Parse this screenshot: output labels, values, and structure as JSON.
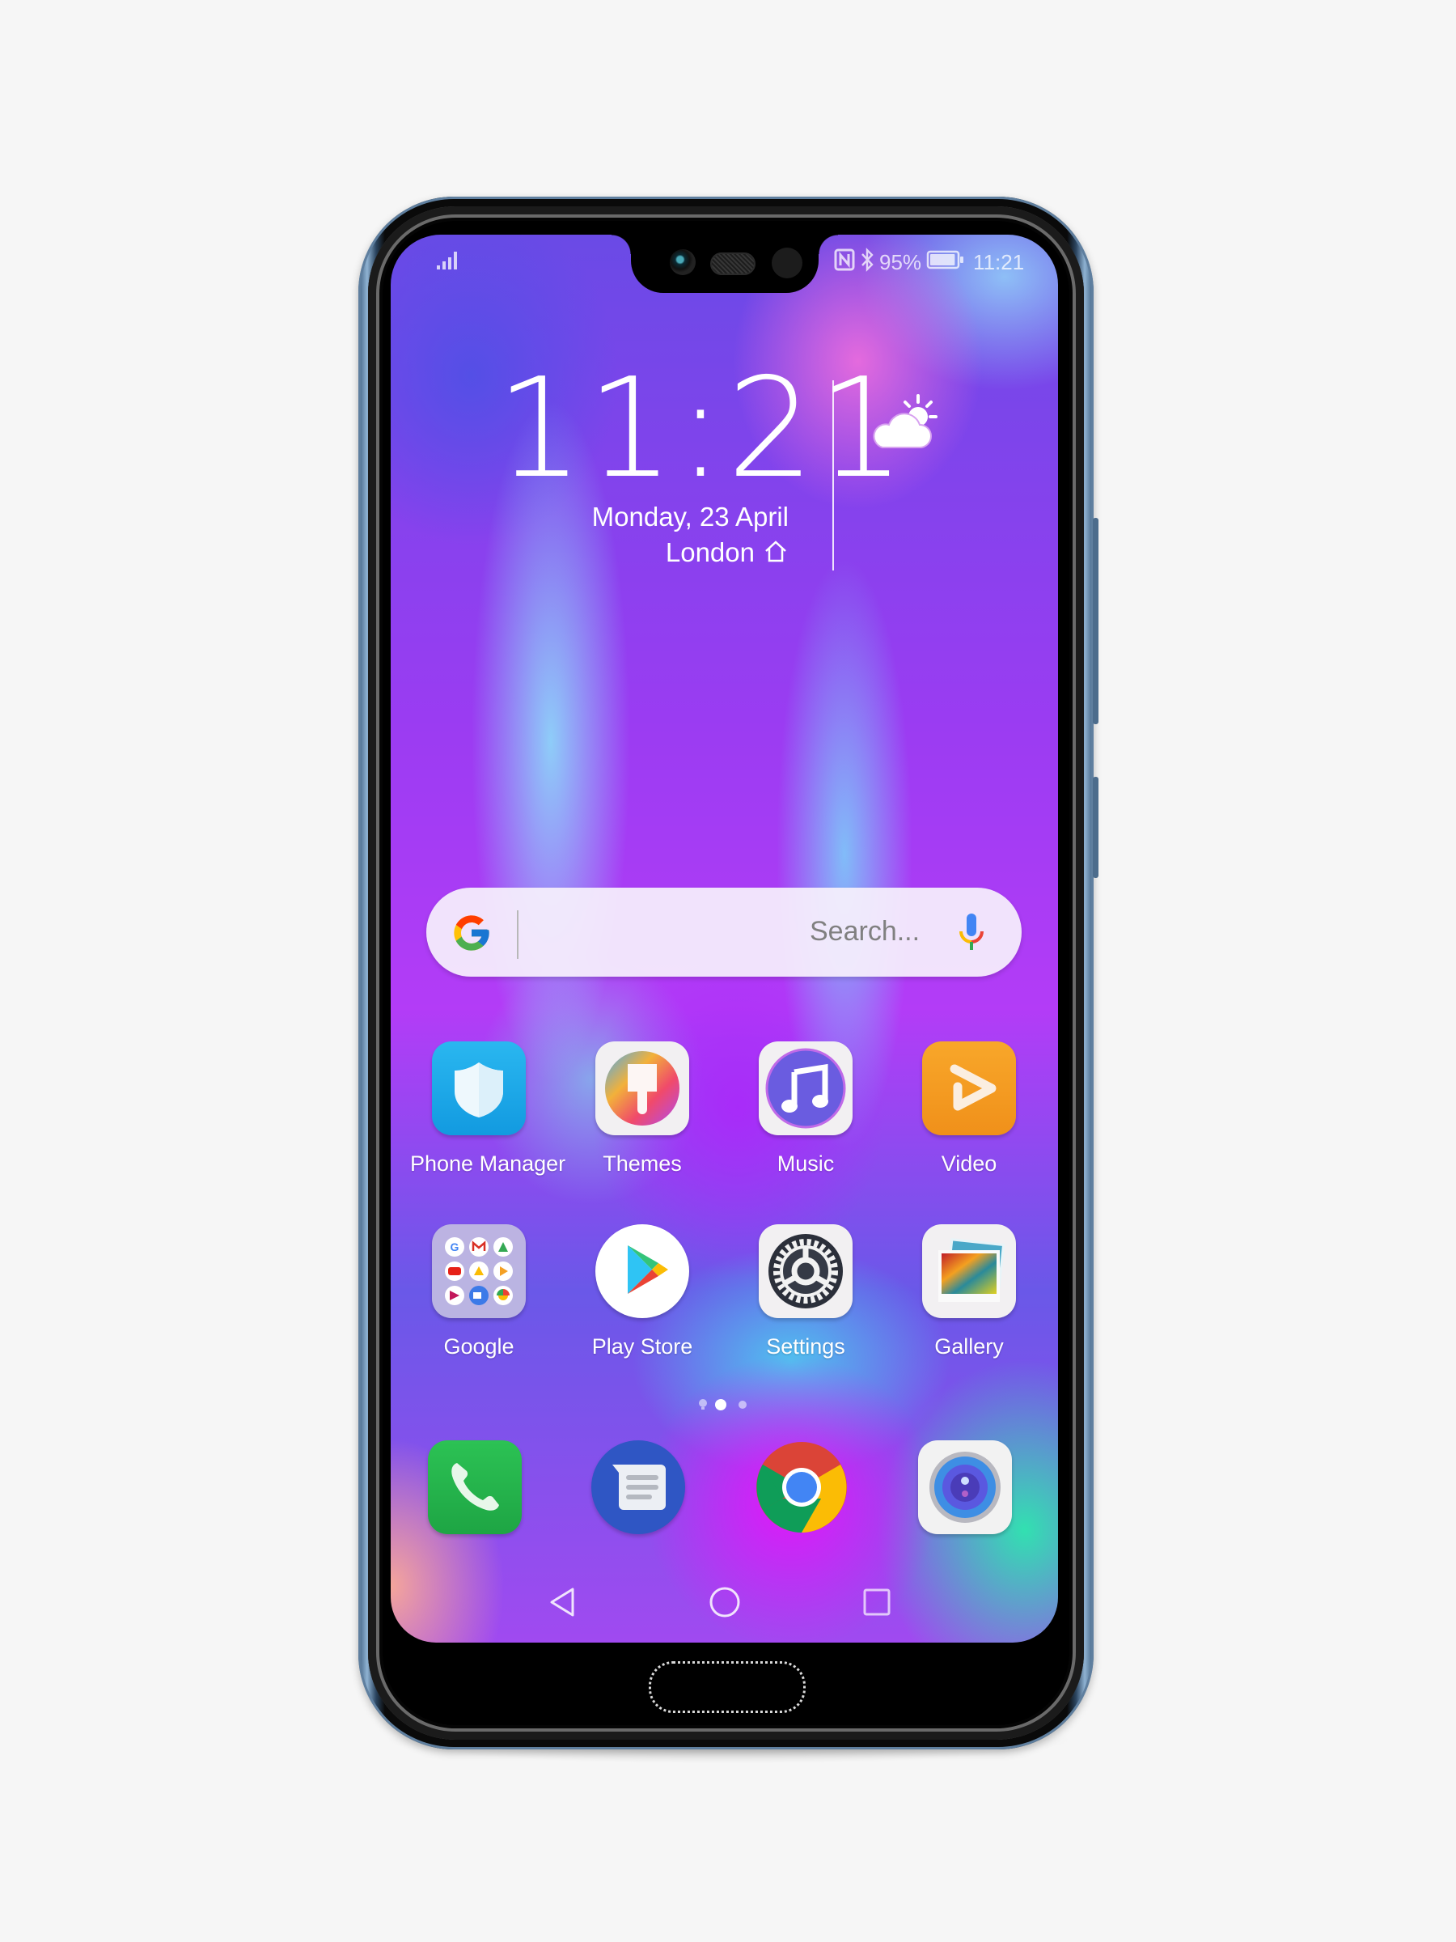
{
  "device": {
    "frame_color": "#5f7f9f",
    "screen_theme_colors": [
      "#6a4ae6",
      "#b33cf7",
      "#8ce6fa",
      "#f06edc",
      "#28f0aa"
    ]
  },
  "status_bar": {
    "signal_icon": "signal-bars-icon",
    "nfc_icon": "nfc-icon",
    "bluetooth_icon": "bluetooth-icon",
    "battery_percent": "95%",
    "battery_icon": "battery-icon",
    "battery_level": 0.95,
    "time": "11:21"
  },
  "clock_widget": {
    "time": "11:21",
    "date": "Monday, 23 April",
    "location": "London",
    "location_icon": "home-icon",
    "weather_icon": "partly-cloudy-icon"
  },
  "search_widget": {
    "logo": "google-g-icon",
    "placeholder": "Search...",
    "voice_icon": "microphone-icon"
  },
  "apps": [
    {
      "label": "Phone Manager",
      "icon": "shield-icon",
      "color": "#16a6e6"
    },
    {
      "label": "Themes",
      "icon": "paintbrush-icon",
      "color": "#f0f0f0"
    },
    {
      "label": "Music",
      "icon": "music-note-icon",
      "color": "#6a5ce0"
    },
    {
      "label": "Video",
      "icon": "play-icon",
      "color": "#f59b1c"
    },
    {
      "label": "Google",
      "icon": "folder-icon",
      "color": "#b6b4d6"
    },
    {
      "label": "Play Store",
      "icon": "play-store-icon",
      "color": "#ffffff"
    },
    {
      "label": "Settings",
      "icon": "gear-icon",
      "color": "#2b2f3a"
    },
    {
      "label": "Gallery",
      "icon": "photos-icon",
      "color": "#f0f0f0"
    }
  ],
  "page_indicator": {
    "pages": 3,
    "current": 2,
    "first_icon": "lightbulb-icon"
  },
  "dock": [
    {
      "name": "Phone",
      "icon": "phone-icon",
      "color": "#22b04a"
    },
    {
      "name": "Messages",
      "icon": "messages-icon",
      "color": "#2f56c4"
    },
    {
      "name": "Chrome",
      "icon": "chrome-icon",
      "color": "#4285f4"
    },
    {
      "name": "Camera",
      "icon": "camera-icon",
      "color": "#f0f0f0"
    }
  ],
  "nav_bar": {
    "back": "back-triangle-icon",
    "home": "home-circle-icon",
    "recents": "recents-square-icon"
  }
}
